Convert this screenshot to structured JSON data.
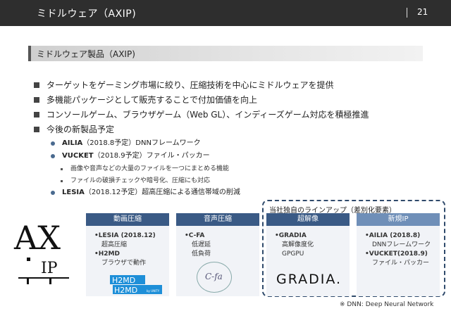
{
  "header": {
    "title": "ミドルウェア（AXIP)",
    "page_number": "21"
  },
  "section": {
    "title": "ミドルウェア製品（AXIP)"
  },
  "bullets": [
    "ターゲットをゲーミング市場に絞り、圧縮技術を中心にミドルウェアを提供",
    "多機能パッケージとして販売することで付加価値を向上",
    "コンソールゲーム、ブラウザゲーム（Web GL）、インディーズゲーム対応を積極推進",
    "今後の新製品予定"
  ],
  "sub_bullets": [
    {
      "name": "AILIA",
      "detail": "（2018.8予定）DNNフレームワーク"
    },
    {
      "name": "VUCKET",
      "detail": "（2018.9予定）ファイル・パッカー"
    },
    {
      "name": "LESIA",
      "detail": "（2018.12予定）超高圧縮による通信帯域の削減"
    }
  ],
  "sub_sub_bullets": [
    "画像や音声などの大量のファイルを一つにまとめる機能",
    "ファイルの破損チェックや暗号化、圧縮にも対応"
  ],
  "lineup_title": "当社独自のラインアップ（差別化要素）",
  "logo": {
    "text_top": "AX",
    "text_bottom": "IP"
  },
  "cards": [
    {
      "header": "動画圧縮",
      "lines": [
        "•LESIA (2018.12)",
        "超高圧縮",
        "•H2MD",
        "ブラウザで動作"
      ]
    },
    {
      "header": "音声圧縮",
      "lines": [
        "•C-FA",
        "低遅延",
        "低負荷"
      ]
    },
    {
      "header": "超解像",
      "lines": [
        "•GRADIA",
        "高解像度化",
        "GPGPU"
      ]
    },
    {
      "header": "新規IP",
      "lines": [
        "•AILIA (2018.8)",
        "DNNフレームワーク",
        "•VUCKET(2018.9)",
        "ファイル・パッカー"
      ]
    }
  ],
  "product_logos": {
    "h2md": "H2MD",
    "h2md_sub": "by UNITY",
    "cfa": "C-fa",
    "gradia": "GRADIA."
  },
  "footnote": "※ DNN: Deep Neural Network",
  "colors": {
    "topbar": "#2e2e2e",
    "card_header": "#3a5a85",
    "card_header_alt": "#6f8fb8",
    "bullet_dot": "#4a6a8f"
  }
}
